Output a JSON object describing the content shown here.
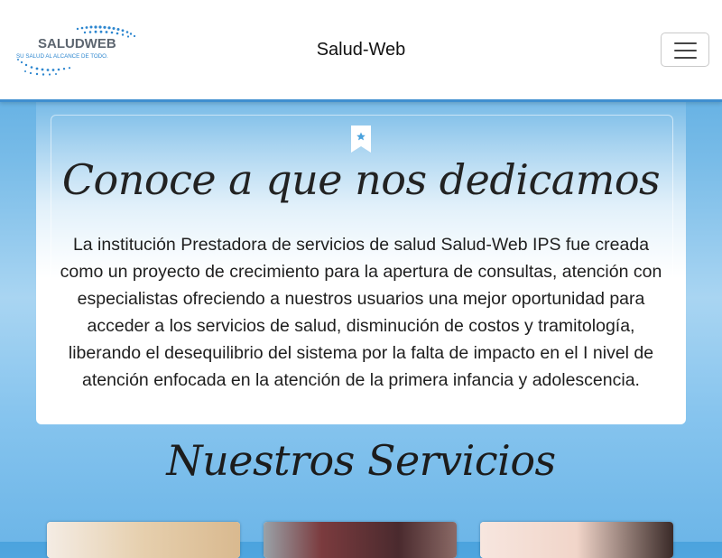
{
  "navbar": {
    "logo_text": "SALUDWEB",
    "logo_tagline": "SU SALUD AL ALCANCE DE TODO.",
    "brand": "Salud-Web",
    "menu_icon": "hamburger-menu-icon"
  },
  "about": {
    "icon": "bookmark-star-icon",
    "title": "Conoce a que nos dedicamos",
    "text": "La institución Prestadora de servicios de salud Salud-Web IPS fue creada como un proyecto de crecimiento para la apertura de consultas, atención con especialistas ofreciendo a nuestros usuarios una mejor oportunidad para acceder a los servicios de salud, disminución de costos y tramitología, liberando el desequilibrio del sistema por la falta de impacto en el I nivel de atención enfocada en la atención de la primera infancia y adolescencia."
  },
  "services": {
    "title": "Nuestros Servicios",
    "cards": [
      {
        "image": "service-photo-1",
        "tone": "#e8d3b8"
      },
      {
        "image": "service-photo-2",
        "tone": "#6b3a3a"
      },
      {
        "image": "service-photo-3",
        "tone": "#f2d9cf"
      }
    ]
  },
  "colors": {
    "accent": "#3f8fd0",
    "logo_blue": "#1f6fb5"
  }
}
